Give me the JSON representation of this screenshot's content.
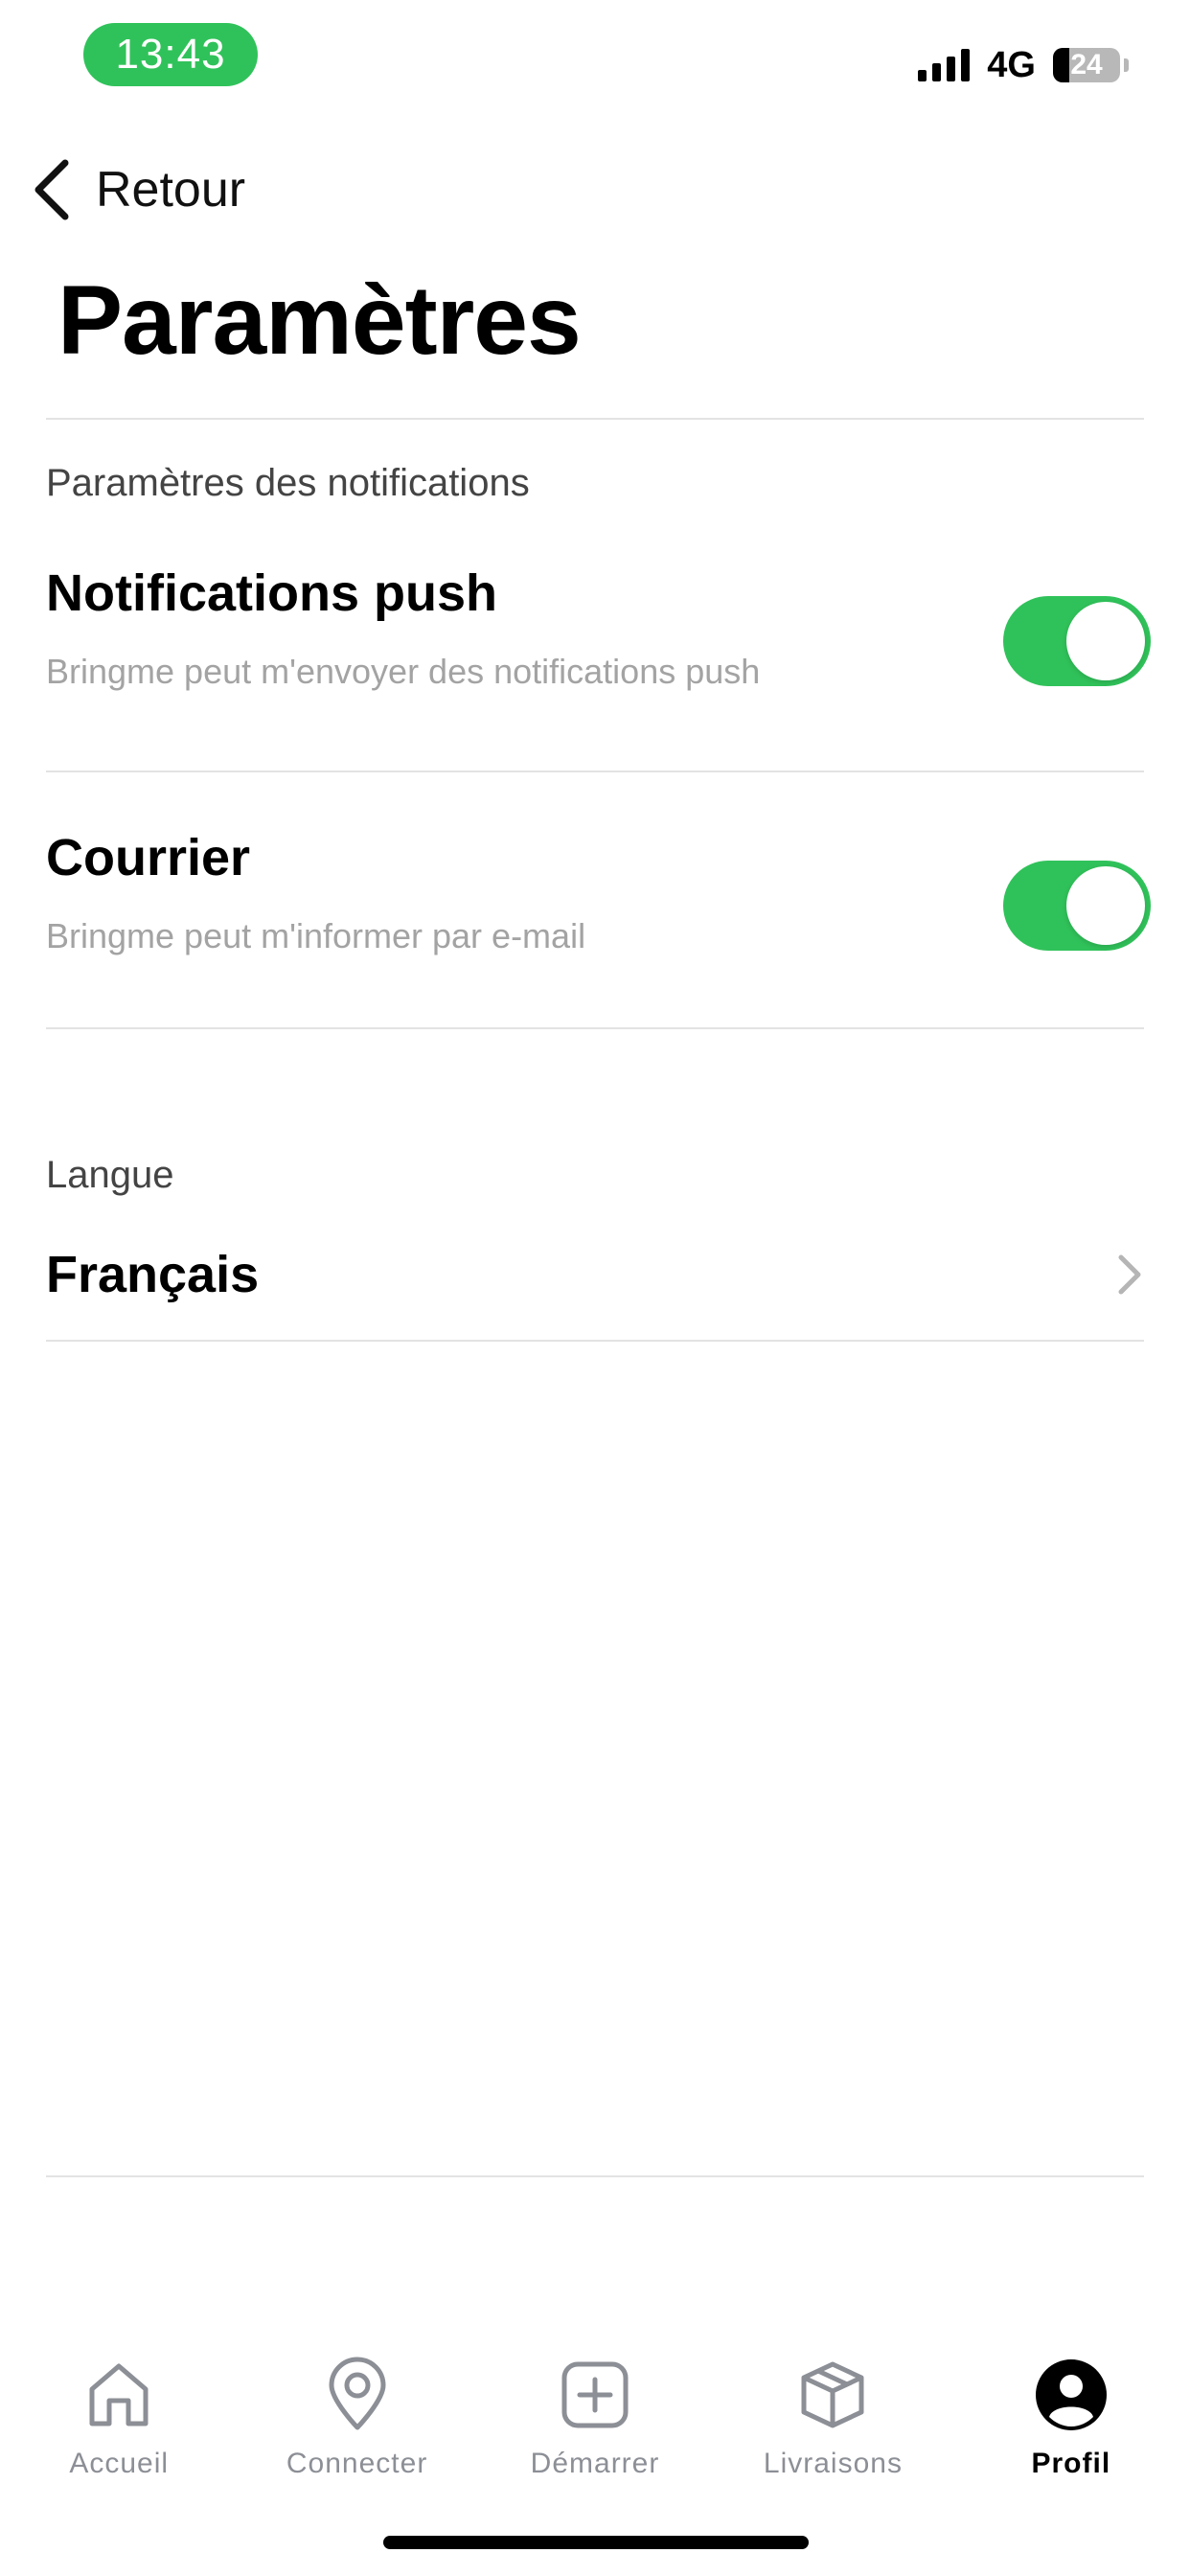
{
  "status_bar": {
    "time": "13:43",
    "network": "4G",
    "battery": "24",
    "battery_fraction": 0.24
  },
  "header": {
    "back_label": "Retour",
    "title": "Paramètres"
  },
  "notifications": {
    "section_label": "Paramètres des notifications",
    "items": [
      {
        "title": "Notifications push",
        "description": "Bringme peut m'envoyer des notifications push",
        "enabled": true
      },
      {
        "title": "Courrier",
        "description": "Bringme peut m'informer par e-mail",
        "enabled": true
      }
    ]
  },
  "language": {
    "section_label": "Langue",
    "value": "Français"
  },
  "tab_bar": {
    "items": [
      {
        "label": "Accueil",
        "icon": "home-icon",
        "active": false
      },
      {
        "label": "Connecter",
        "icon": "location-pin-icon",
        "active": false
      },
      {
        "label": "Démarrer",
        "icon": "plus-square-icon",
        "active": false
      },
      {
        "label": "Livraisons",
        "icon": "package-icon",
        "active": false
      },
      {
        "label": "Profil",
        "icon": "profile-icon",
        "active": true
      }
    ]
  },
  "colors": {
    "accent_green": "#30c25a",
    "divider": "#e3e3e3",
    "muted_text": "#a3a3a3",
    "tab_inactive": "#8c8f96"
  }
}
